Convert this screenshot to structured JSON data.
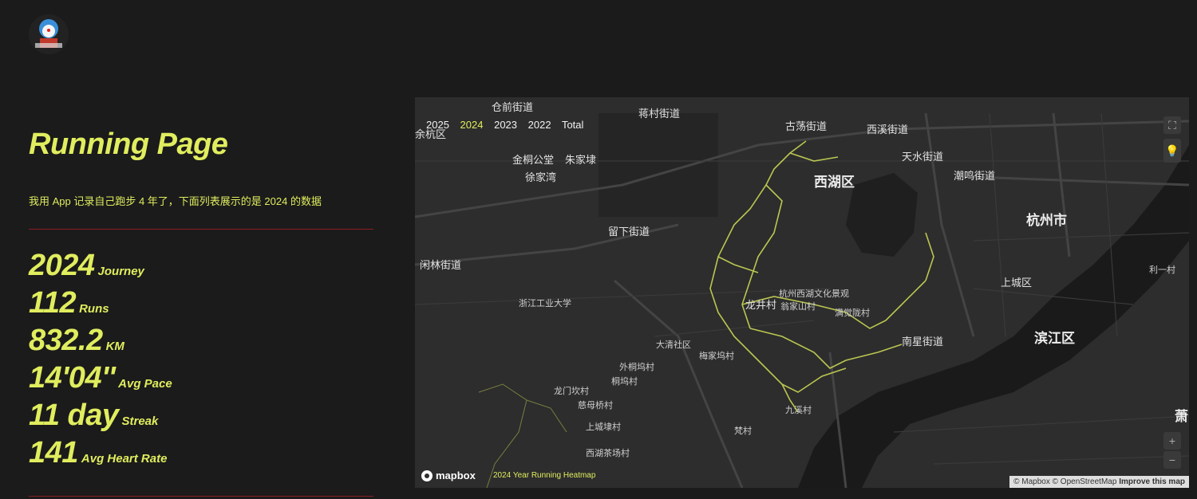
{
  "site": {
    "title": "Running Page",
    "subtitle": "我用 App 记录自己跑步 4 年了，下面列表展示的是 2024 的数据"
  },
  "stats": [
    {
      "value": "2024",
      "label": "Journey"
    },
    {
      "value": "112",
      "label": "Runs"
    },
    {
      "value": "832.2",
      "label": "KM"
    },
    {
      "value": "14'04''",
      "label": "Avg Pace"
    },
    {
      "value": "11 day",
      "label": "Streak"
    },
    {
      "value": "141",
      "label": "Avg Heart Rate"
    }
  ],
  "map": {
    "years": [
      "2025",
      "2024",
      "2023",
      "2022",
      "Total"
    ],
    "active_year": "2024",
    "heatmap_title": "2024 Year Running Heatmap",
    "logo": "mapbox",
    "attribution": {
      "mapbox": "© Mapbox",
      "osm": "© OpenStreetMap",
      "improve": "Improve this map"
    },
    "zoom_in": "+",
    "zoom_out": "−",
    "labels": {
      "yuhang": "余杭区",
      "cangqian": "仓前街道",
      "jiangcun": "蒋村街道",
      "gudang": "古荡街道",
      "xixi": "西溪街道",
      "xihu_district": "西湖区",
      "tianshui": "天水街道",
      "chaoming": "潮鸣街道",
      "hangzhou": "杭州市",
      "jinghe": "金桐公堂",
      "zhujiadai": "朱家埭",
      "xujiawan": "徐家湾",
      "liuxia": "留下街道",
      "xianlin": "闲林街道",
      "zhejiang_tech": "浙江工业大学",
      "longjing": "龙井村",
      "wengjiashan": "翁家山村",
      "manjuelong": "满觉陇村",
      "scenic": "杭州西湖文化景观",
      "shangcheng": "上城区",
      "nanxing": "南星街道",
      "binjiang": "滨江区",
      "daqing": "大清社区",
      "meijiawu": "梅家坞村",
      "waitong": "外桐坞村",
      "tongwu": "桐坞村",
      "longmenkan": "龙门坎村",
      "ciyunqiao": "慈母桥村",
      "shangchengdai": "上城埭村",
      "xihuchachang": "西湖茶场村",
      "jiuxi": "九溪村",
      "fanc": "梵村",
      "liyi": "利一村",
      "xiao": "萧"
    }
  }
}
